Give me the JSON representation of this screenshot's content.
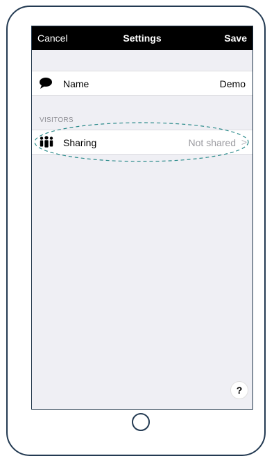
{
  "navbar": {
    "cancel_label": "Cancel",
    "title": "Settings",
    "save_label": "Save"
  },
  "rows": {
    "name": {
      "icon": "speech-bubble-icon",
      "label": "Name",
      "value": "Demo"
    },
    "sharing": {
      "icon": "people-icon",
      "label": "Sharing",
      "value": "Not shared",
      "chevron": ">"
    }
  },
  "sections": {
    "visitors_header": "VISITORS"
  },
  "help": {
    "label": "?"
  },
  "colors": {
    "navbar_bg": "#000000",
    "screen_bg": "#efeff4",
    "device_frame": "#233a52",
    "highlight_dash": "#2a8a8a",
    "secondary_text": "#9b9ba0"
  }
}
